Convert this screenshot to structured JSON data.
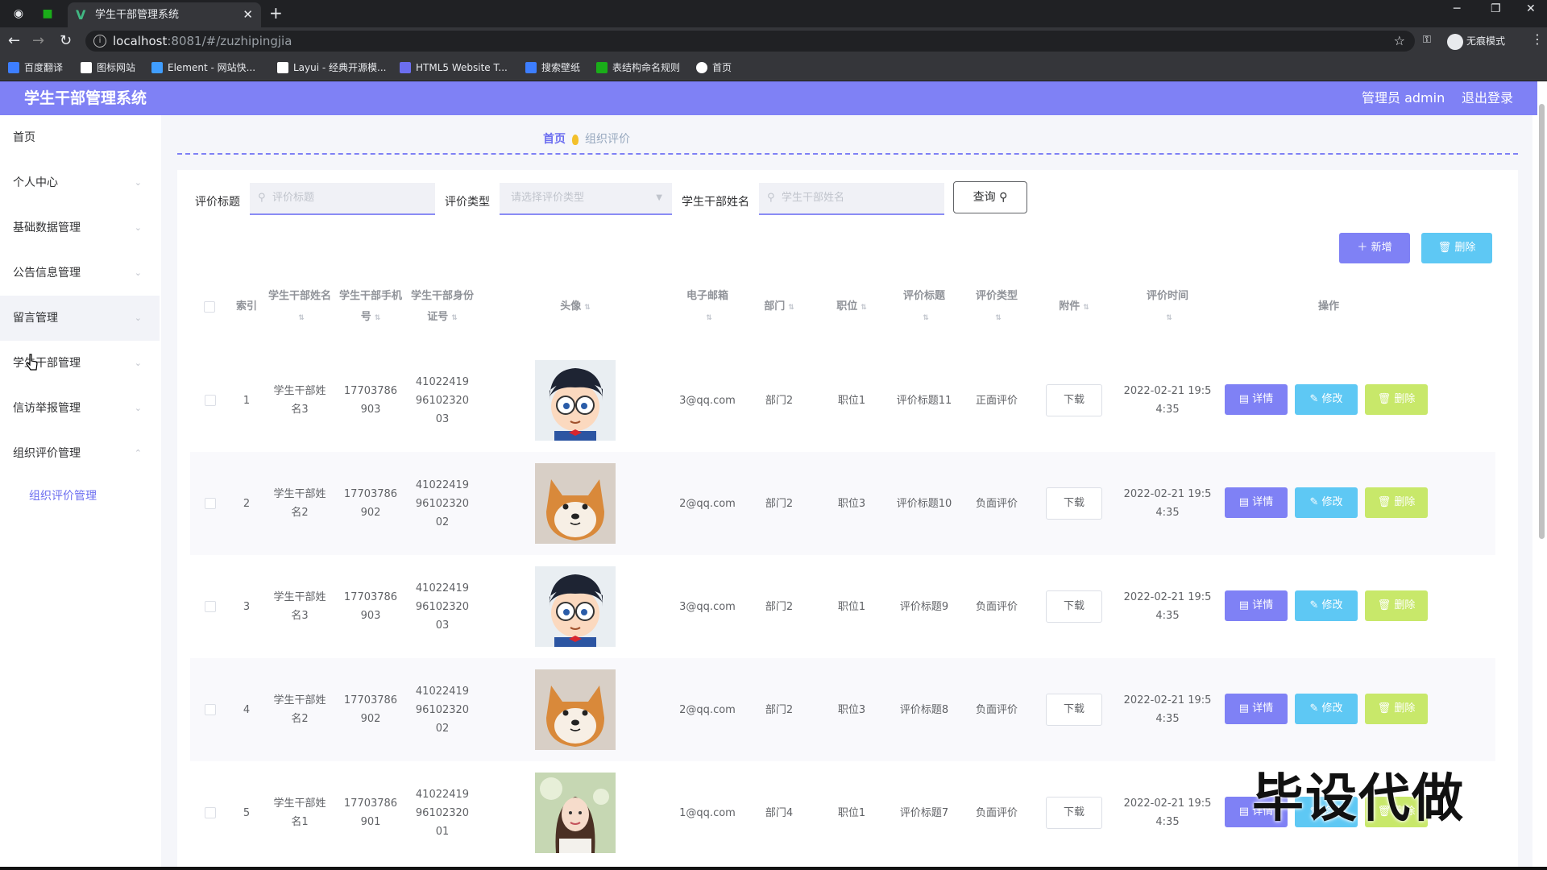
{
  "browser": {
    "tab_title": "学生干部管理系统",
    "url_host": "localhost",
    "url_rest": ":8081/#/zuzhipingjia",
    "incognito_label": "无痕模式",
    "bookmarks": [
      {
        "label": "百度翻译",
        "color": "#3d7eff"
      },
      {
        "label": "图标网站",
        "color": "#ffffff"
      },
      {
        "label": "Element - 网站快...",
        "color": "#409eff"
      },
      {
        "label": "Layui - 经典开源模...",
        "color": "#ffffff"
      },
      {
        "label": "HTML5 Website T...",
        "color": "#6c6ef0"
      },
      {
        "label": "搜索壁纸",
        "color": "#3d7eff"
      },
      {
        "label": "表结构命名规则",
        "color": "#1aad19"
      },
      {
        "label": "首页",
        "color": "#ffffff"
      }
    ]
  },
  "header": {
    "title": "学生干部管理系统",
    "user": "管理员 admin",
    "logout": "退出登录"
  },
  "sidebar": {
    "items": [
      {
        "label": "首页"
      },
      {
        "label": "个人中心"
      },
      {
        "label": "基础数据管理"
      },
      {
        "label": "公告信息管理"
      },
      {
        "label": "留言管理"
      },
      {
        "label": "学生干部管理"
      },
      {
        "label": "信访举报管理"
      },
      {
        "label": "组织评价管理"
      }
    ],
    "sub_item": "组织评价管理"
  },
  "breadcrumb": {
    "home": "首页",
    "current": "组织评价"
  },
  "filters": {
    "title_label": "评价标题",
    "title_placeholder": "评价标题",
    "type_label": "评价类型",
    "type_placeholder": "请选择评价类型",
    "name_label": "学生干部姓名",
    "name_placeholder": "学生干部姓名",
    "query_button": "查询"
  },
  "actions": {
    "add": "新增",
    "delete": "删除"
  },
  "table": {
    "headers": {
      "index": "索引",
      "name": "学生干部姓名",
      "phone": "学生干部手机号",
      "idcard": "学生干部身份证号",
      "avatar": "头像",
      "email": "电子邮箱",
      "dept": "部门",
      "position": "职位",
      "title": "评价标题",
      "type": "评价类型",
      "attachment": "附件",
      "time": "评价时间",
      "ops": "操作"
    },
    "download_label": "下载",
    "op_detail": "详情",
    "op_edit": "修改",
    "op_delete": "删除",
    "rows": [
      {
        "index": "1",
        "name": "学生干部姓名3",
        "phone": "17703786903",
        "idcard": "410224199610232003",
        "email": "3@qq.com",
        "dept": "部门2",
        "position": "职位1",
        "title": "评价标题11",
        "type": "正面评价",
        "time": "2022-02-21 19:54:35",
        "avatar": "conan"
      },
      {
        "index": "2",
        "name": "学生干部姓名2",
        "phone": "17703786902",
        "idcard": "410224199610232002",
        "email": "2@qq.com",
        "dept": "部门2",
        "position": "职位3",
        "title": "评价标题10",
        "type": "负面评价",
        "time": "2022-02-21 19:54:35",
        "avatar": "shiba"
      },
      {
        "index": "3",
        "name": "学生干部姓名3",
        "phone": "17703786903",
        "idcard": "410224199610232003",
        "email": "3@qq.com",
        "dept": "部门2",
        "position": "职位1",
        "title": "评价标题9",
        "type": "负面评价",
        "time": "2022-02-21 19:54:35",
        "avatar": "conan"
      },
      {
        "index": "4",
        "name": "学生干部姓名2",
        "phone": "17703786902",
        "idcard": "410224199610232002",
        "email": "2@qq.com",
        "dept": "部门2",
        "position": "职位3",
        "title": "评价标题8",
        "type": "负面评价",
        "time": "2022-02-21 19:54:35",
        "avatar": "shiba"
      },
      {
        "index": "5",
        "name": "学生干部姓名1",
        "phone": "17703786901",
        "idcard": "410224199610232001",
        "email": "1@qq.com",
        "dept": "部门4",
        "position": "职位1",
        "title": "评价标题7",
        "type": "负面评价",
        "time": "2022-02-21 19:54:35",
        "avatar": "girl"
      }
    ]
  },
  "watermark": "毕设代做",
  "colors": {
    "accent": "#7f81f5",
    "info": "#5ec8f4",
    "warning": "#c8e86a"
  }
}
